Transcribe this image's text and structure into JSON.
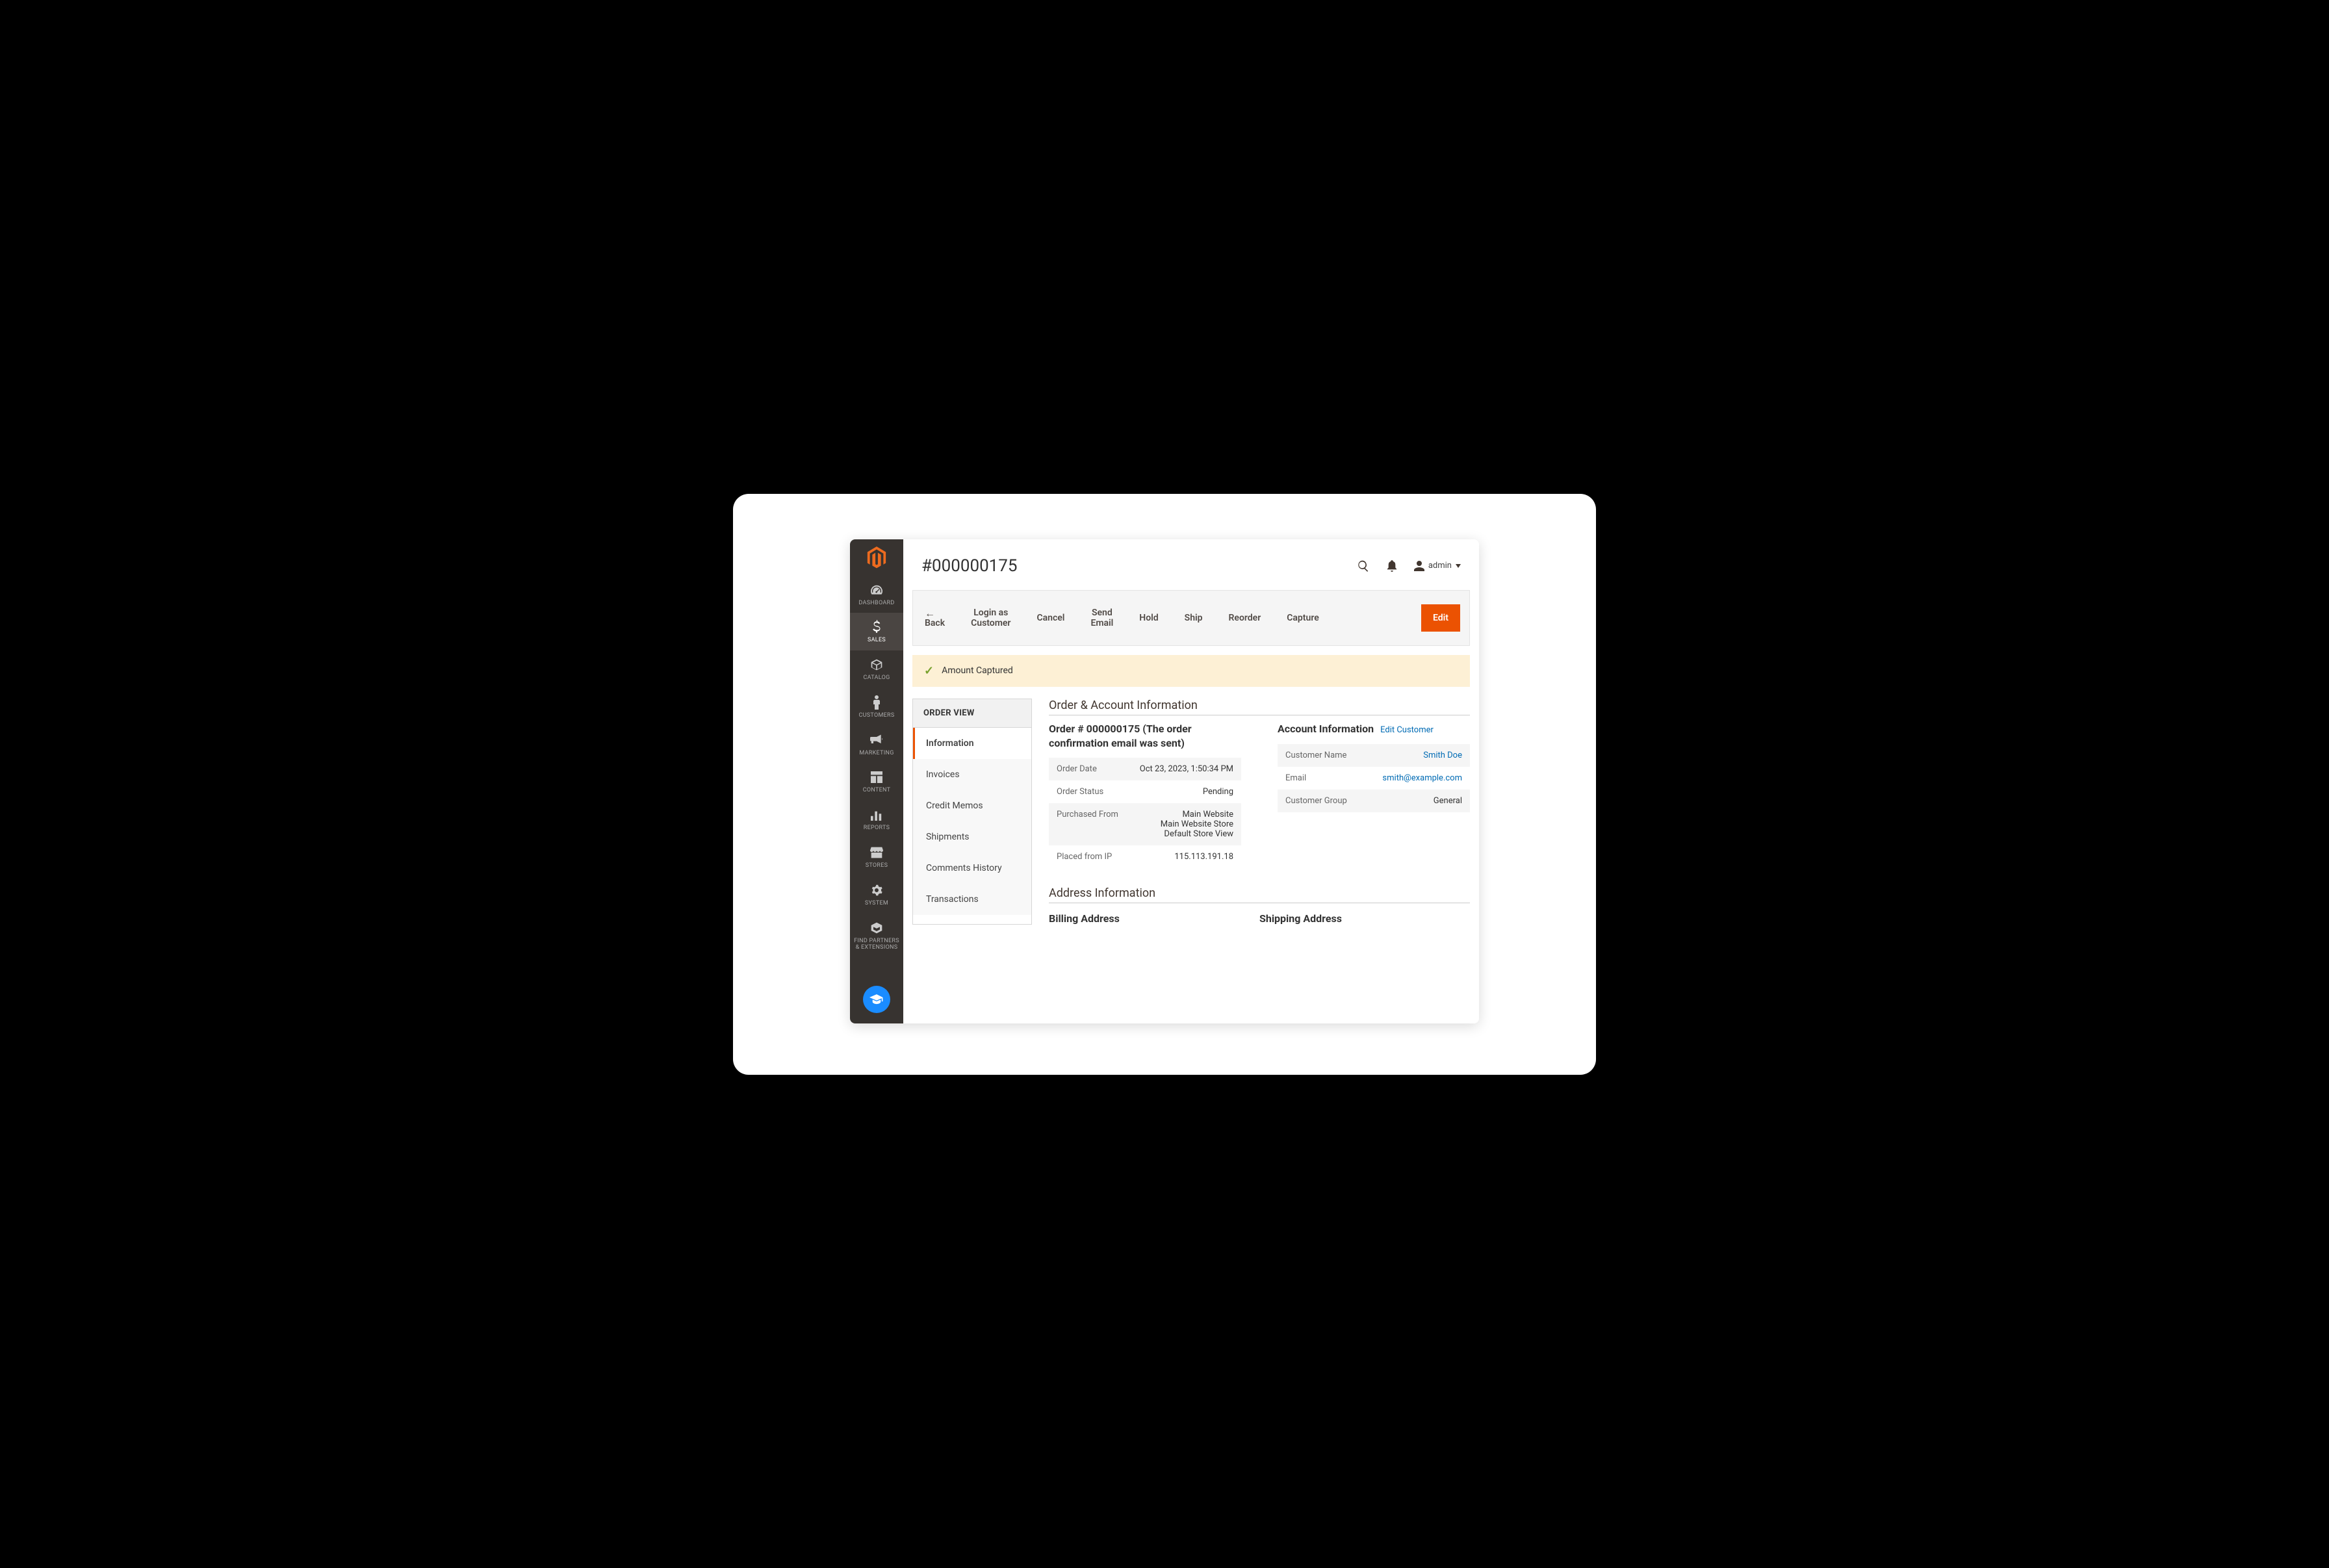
{
  "header": {
    "page_title": "#000000175",
    "user_label": "admin"
  },
  "sidebar": {
    "items": [
      {
        "label": "DASHBOARD"
      },
      {
        "label": "SALES"
      },
      {
        "label": "CATALOG"
      },
      {
        "label": "CUSTOMERS"
      },
      {
        "label": "MARKETING"
      },
      {
        "label": "CONTENT"
      },
      {
        "label": "REPORTS"
      },
      {
        "label": "STORES"
      },
      {
        "label": "SYSTEM"
      },
      {
        "label": "FIND PARTNERS & EXTENSIONS"
      }
    ]
  },
  "toolbar": {
    "back": "Back",
    "login_as_customer_l1": "Login as",
    "login_as_customer_l2": "Customer",
    "cancel": "Cancel",
    "send_email_l1": "Send",
    "send_email_l2": "Email",
    "hold": "Hold",
    "ship": "Ship",
    "reorder": "Reorder",
    "capture": "Capture",
    "edit": "Edit"
  },
  "success_message": "Amount Captured",
  "order_nav": {
    "header": "ORDER VIEW",
    "items": [
      "Information",
      "Invoices",
      "Credit Memos",
      "Shipments",
      "Comments History",
      "Transactions"
    ]
  },
  "sections": {
    "order_account_title": "Order & Account Information",
    "order_sub_title": "Order # 000000175 (The order confirmation email was sent)",
    "account_sub_title": "Account Information",
    "edit_customer": "Edit Customer",
    "address_title": "Address Information",
    "billing_label": "Billing Address",
    "shipping_label": "Shipping Address"
  },
  "order_info": {
    "date_label": "Order Date",
    "date_value": "Oct 23, 2023, 1:50:34 PM",
    "status_label": "Order Status",
    "status_value": "Pending",
    "purchased_label": "Purchased From",
    "purchased_l1": "Main Website",
    "purchased_l2": "Main Website Store",
    "purchased_l3": "Default Store View",
    "ip_label": "Placed from IP",
    "ip_value": "115.113.191.18"
  },
  "account_info": {
    "name_label": "Customer Name",
    "name_value": "Smith Doe",
    "email_label": "Email",
    "email_value": "smith@example.com",
    "group_label": "Customer Group",
    "group_value": "General"
  }
}
